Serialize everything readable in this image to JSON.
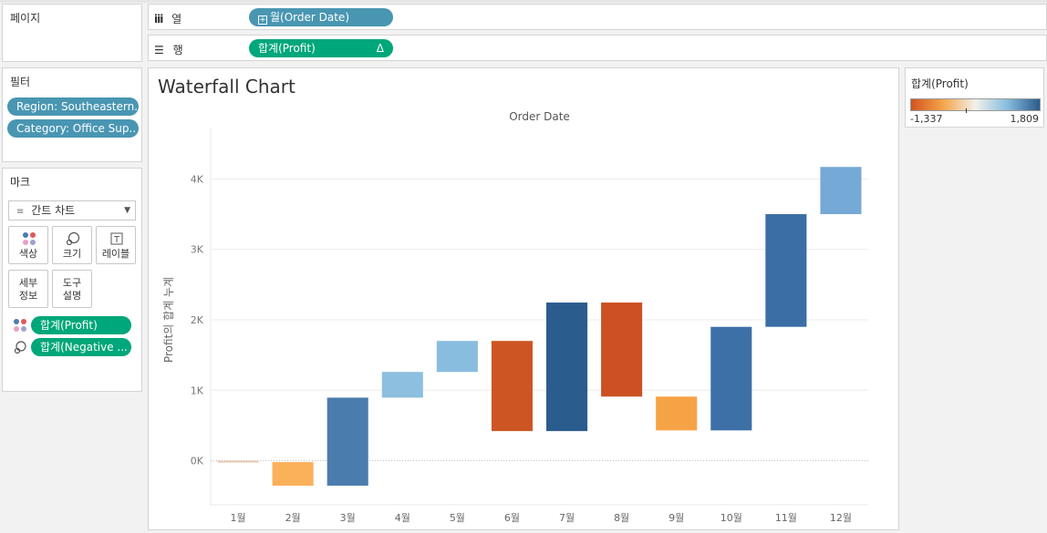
{
  "shelves": {
    "pages_label": "페이지",
    "columns_label": "열",
    "rows_label": "행",
    "columns_pill": "월(Order Date)",
    "rows_pill": "합계(Profit)",
    "rows_pill_delta": "Δ"
  },
  "filters": {
    "title": "필터",
    "items": [
      "Region: Southeastern..",
      "Category: Office Sup.."
    ]
  },
  "marks": {
    "title": "마크",
    "type": "간트 차트",
    "buttons": {
      "color": "색상",
      "size": "크기",
      "label": "레이블",
      "detail": "세부\n정보",
      "tooltip": "도구\n설명"
    },
    "fields": [
      "합계(Profit)",
      "합계(Negative ..."
    ]
  },
  "legend": {
    "title": "합계(Profit)",
    "min_label": "-1,337",
    "max_label": "1,809",
    "colors": [
      "#d15420",
      "#f5a54a",
      "#f2f0ea",
      "#86bcdd",
      "#2a5a8c"
    ]
  },
  "chart_data": {
    "type": "bar",
    "subtype": "waterfall (gantt bars from running total)",
    "title": "Waterfall Chart",
    "top_label": "Order Date",
    "ylabel": "Profit의 합계 누계",
    "ylim": [
      -600,
      4600
    ],
    "yticks": [
      0,
      1000,
      2000,
      3000,
      4000
    ],
    "ytick_labels": [
      "0K",
      "1K",
      "2K",
      "3K",
      "4K"
    ],
    "categories": [
      "1월",
      "2월",
      "3월",
      "4월",
      "5월",
      "6월",
      "7월",
      "8월",
      "9월",
      "10월",
      "11월",
      "12월"
    ],
    "starts": [
      0,
      -20,
      -355,
      895,
      1260,
      1700,
      420,
      2245,
      910,
      430,
      1900,
      3500
    ],
    "values": [
      -20,
      -335,
      1250,
      365,
      440,
      -1280,
      1825,
      -1335,
      -480,
      1470,
      1600,
      670
    ],
    "colors": [
      "#e8c8b0",
      "#fbb05a",
      "#4a7cad",
      "#8dbfe0",
      "#89bde0",
      "#cd5523",
      "#2a5c8d",
      "#cc5023",
      "#f6a346",
      "#3d70a7",
      "#3a6ea5",
      "#75a9d6"
    ]
  }
}
